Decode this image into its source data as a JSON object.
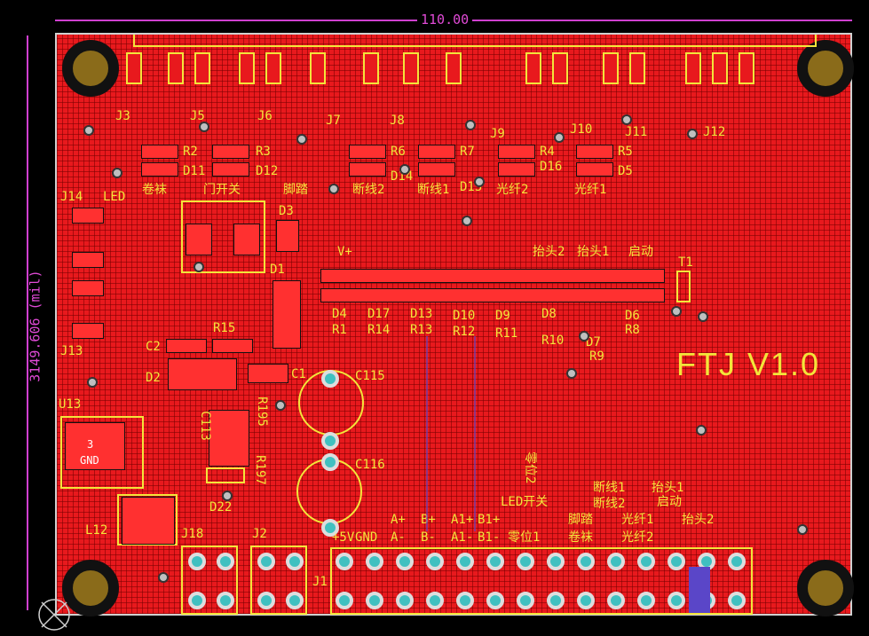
{
  "dimensions": {
    "width_label": "110.00",
    "height_label": "3149.606 (mil)"
  },
  "board_title": "FTJ V1.0",
  "connector_labels": [
    "J3",
    "J5",
    "J6",
    "J7",
    "J8",
    "J9",
    "J10",
    "J11",
    "J12",
    "J14",
    "J13",
    "J18",
    "J2",
    "J1",
    "L12",
    "U13"
  ],
  "top_function_labels": [
    "卷袜",
    "门开关",
    "脚踏",
    "断线2",
    "断线1",
    "光纤2",
    "光纤1"
  ],
  "resistor_labels": [
    "R2",
    "R3",
    "R6",
    "R7",
    "R4",
    "R5",
    "R15",
    "R1",
    "R14",
    "R13",
    "R12",
    "R11",
    "R10",
    "R9",
    "R8",
    "R195",
    "R197"
  ],
  "diode_labels": [
    "D11",
    "D12",
    "D14",
    "D15",
    "D16",
    "D5",
    "D3",
    "D1",
    "D4",
    "D17",
    "D13",
    "D10",
    "D9",
    "D8",
    "D7",
    "D6",
    "D2",
    "D22"
  ],
  "cap_labels": [
    "C2",
    "C1",
    "C115",
    "C116",
    "C113"
  ],
  "misc_labels": {
    "led": "LED",
    "vplus": "V+",
    "t1": "T1",
    "u13_pin": "3",
    "u13_net": "GND",
    "row_labels": [
      "抬头2",
      "抬头1",
      "启动"
    ]
  },
  "bottom_labels_row1": [
    "+5V",
    "GND",
    "A-",
    "B-",
    "A1-",
    "B1-",
    "零位1",
    "卷袜",
    "光纤2"
  ],
  "bottom_labels_row2": [
    "A+",
    "B+",
    "A1+",
    "B1+",
    "LED开关",
    "脚踏",
    "断线2",
    "光纤1",
    "启动",
    "抬头2"
  ],
  "bottom_labels_row3": [
    "断线1",
    "抬头1"
  ],
  "vertical_label": "零位2"
}
